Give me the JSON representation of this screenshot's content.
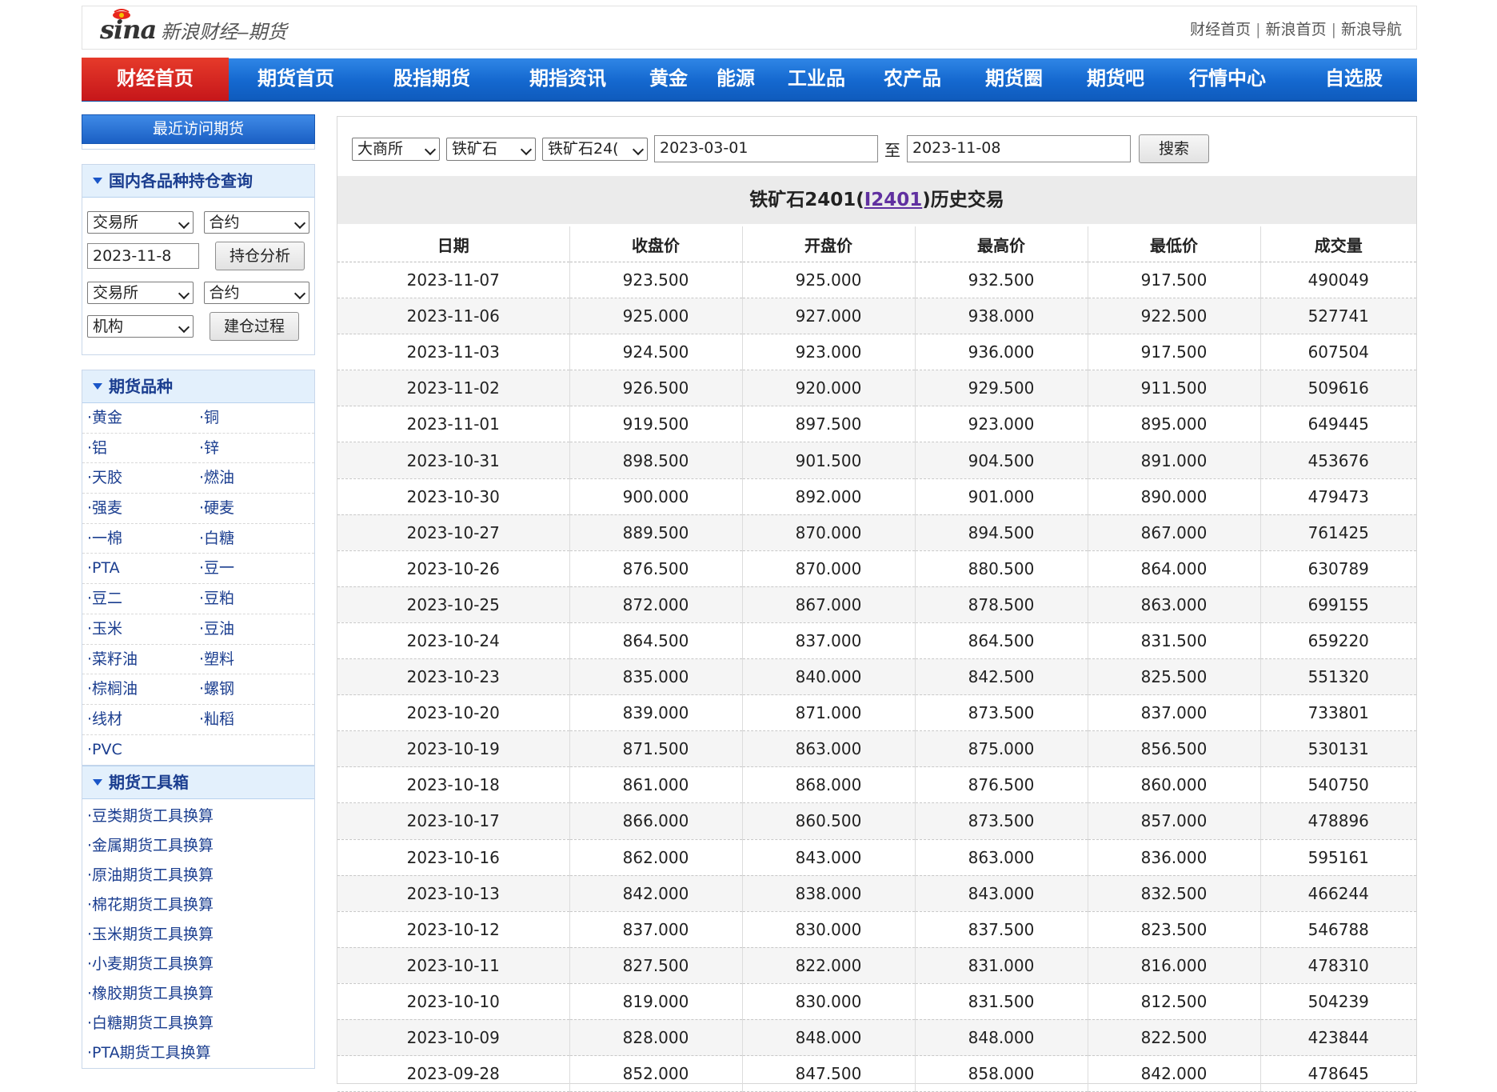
{
  "header": {
    "logo_mark": "sina",
    "logo_text": "新浪财经–期货",
    "links": [
      "财经首页",
      "新浪首页",
      "新浪导航"
    ]
  },
  "nav": {
    "items": [
      "财经首页",
      "期货首页",
      "股指期货",
      "期指资讯",
      "黄金",
      "能源",
      "工业品",
      "农产品",
      "期货圈",
      "期货吧",
      "行情中心",
      "自选股"
    ],
    "active_index": 0,
    "colors": {
      "bar": "#1468cf",
      "active": "#d0201f"
    }
  },
  "sidebar": {
    "recent_label": "最近访问期货",
    "position_query": {
      "title": "国内各品种持仓查询",
      "exchange_select_1": "交易所",
      "contract_select_1": "合约",
      "date_value": "2023-11-8",
      "analysis_button": "持仓分析",
      "exchange_select_2": "交易所",
      "contract_select_2": "合约",
      "institution_select": "机构",
      "process_button": "建仓过程"
    },
    "varieties": {
      "title": "期货品种",
      "items": [
        "·黄金",
        "·铜",
        "·铝",
        "·锌",
        "·天胶",
        "·燃油",
        "·强麦",
        "·硬麦",
        "·一棉",
        "·白糖",
        "·PTA",
        "·豆一",
        "·豆二",
        "·豆粕",
        "·玉米",
        "·豆油",
        "·菜籽油",
        "·塑料",
        "·棕榈油",
        "·螺钢",
        "·线材",
        "·籼稻",
        "·PVC"
      ]
    },
    "toolbox": {
      "title": "期货工具箱",
      "items": [
        "·豆类期货工具换算",
        "·金属期货工具换算",
        "·原油期货工具换算",
        "·棉花期货工具换算",
        "·玉米期货工具换算",
        "·小麦期货工具换算",
        "·橡胶期货工具换算",
        "·白糖期货工具换算",
        "·PTA期货工具换算"
      ]
    }
  },
  "search": {
    "exchange": "大商所",
    "variety": "铁矿石",
    "contract": "铁矿石24(",
    "start_date": "2023-03-01",
    "to_label": "至",
    "end_date": "2023-11-08",
    "search_button": "搜索"
  },
  "table": {
    "title_prefix": "铁矿石2401(",
    "title_code": "I2401",
    "title_suffix": ")历史交易",
    "columns": [
      "日期",
      "收盘价",
      "开盘价",
      "最高价",
      "最低价",
      "成交量"
    ],
    "rows": [
      [
        "2023-11-07",
        "923.500",
        "925.000",
        "932.500",
        "917.500",
        "490049"
      ],
      [
        "2023-11-06",
        "925.000",
        "927.000",
        "938.000",
        "922.500",
        "527741"
      ],
      [
        "2023-11-03",
        "924.500",
        "923.000",
        "936.000",
        "917.500",
        "607504"
      ],
      [
        "2023-11-02",
        "926.500",
        "920.000",
        "929.500",
        "911.500",
        "509616"
      ],
      [
        "2023-11-01",
        "919.500",
        "897.500",
        "923.000",
        "895.000",
        "649445"
      ],
      [
        "2023-10-31",
        "898.500",
        "901.500",
        "904.500",
        "891.000",
        "453676"
      ],
      [
        "2023-10-30",
        "900.000",
        "892.000",
        "901.000",
        "890.000",
        "479473"
      ],
      [
        "2023-10-27",
        "889.500",
        "870.000",
        "894.500",
        "867.000",
        "761425"
      ],
      [
        "2023-10-26",
        "876.500",
        "870.000",
        "880.500",
        "864.000",
        "630789"
      ],
      [
        "2023-10-25",
        "872.000",
        "867.000",
        "878.500",
        "863.000",
        "699155"
      ],
      [
        "2023-10-24",
        "864.500",
        "837.000",
        "864.500",
        "831.500",
        "659220"
      ],
      [
        "2023-10-23",
        "835.000",
        "840.000",
        "842.500",
        "825.500",
        "551320"
      ],
      [
        "2023-10-20",
        "839.000",
        "871.000",
        "873.500",
        "837.000",
        "733801"
      ],
      [
        "2023-10-19",
        "871.500",
        "863.000",
        "875.000",
        "856.500",
        "530131"
      ],
      [
        "2023-10-18",
        "861.000",
        "868.000",
        "876.500",
        "860.000",
        "540750"
      ],
      [
        "2023-10-17",
        "866.000",
        "860.500",
        "873.500",
        "857.000",
        "478896"
      ],
      [
        "2023-10-16",
        "862.000",
        "843.000",
        "863.000",
        "836.000",
        "595161"
      ],
      [
        "2023-10-13",
        "842.000",
        "838.000",
        "843.000",
        "832.500",
        "466244"
      ],
      [
        "2023-10-12",
        "837.000",
        "830.000",
        "837.500",
        "823.500",
        "546788"
      ],
      [
        "2023-10-11",
        "827.500",
        "822.000",
        "831.000",
        "816.000",
        "478310"
      ],
      [
        "2023-10-10",
        "819.000",
        "830.000",
        "831.500",
        "812.500",
        "504239"
      ],
      [
        "2023-10-09",
        "828.000",
        "848.000",
        "848.000",
        "822.500",
        "423844"
      ],
      [
        "2023-09-28",
        "852.000",
        "847.500",
        "858.000",
        "842.000",
        "478645"
      ]
    ]
  }
}
